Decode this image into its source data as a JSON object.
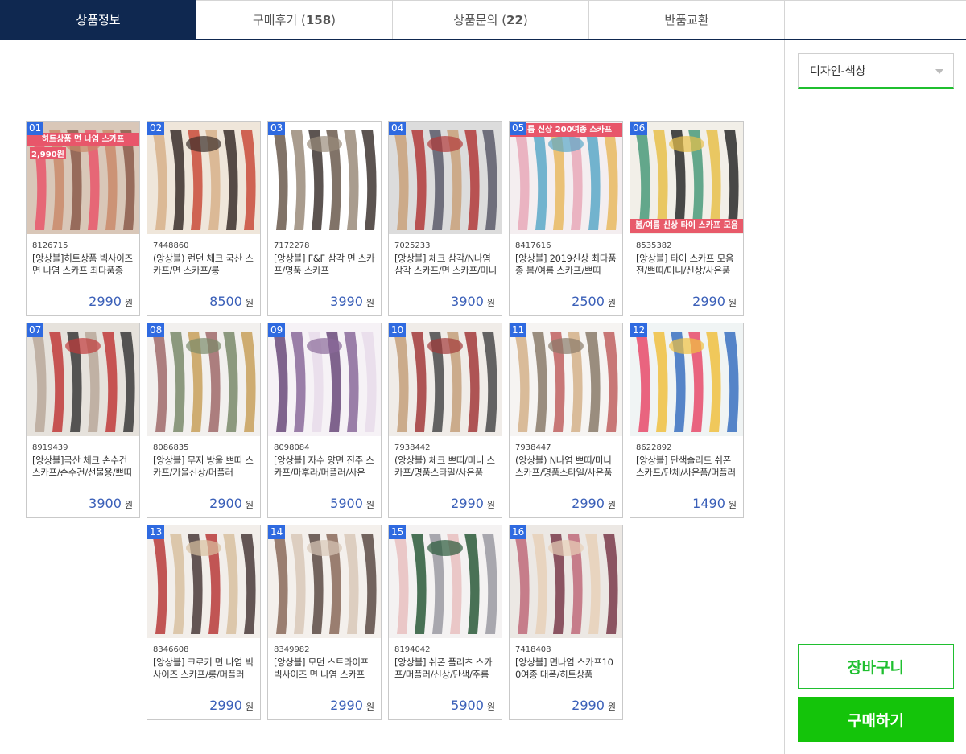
{
  "tabs": [
    {
      "label": "상품정보",
      "count": ""
    },
    {
      "label": "구매후기",
      "count": "158"
    },
    {
      "label": "상품문의",
      "count": "22"
    },
    {
      "label": "반품교환",
      "count": ""
    }
  ],
  "side": {
    "select_value": "디자인-색상",
    "cart_label": "장바구니",
    "buy_label": "구매하기"
  },
  "currency": "원",
  "products": [
    {
      "num": "01",
      "code": "8126715",
      "name": "[앙상블]히트상품 빅사이즈 면 나염 스카프 최다품종",
      "price": "2990",
      "banner": "히트상품 면 나염 스카프",
      "banner2": "2,990원"
    },
    {
      "num": "02",
      "code": "7448860",
      "name": "(앙상블) 런던 체크 국산 스카프/면 스카프/롱",
      "price": "8500"
    },
    {
      "num": "03",
      "code": "7172278",
      "name": "[앙상블] F&F 삼각 면 스카프/명품 스카프",
      "price": "3990"
    },
    {
      "num": "04",
      "code": "7025233",
      "name": "[앙상블] 체크 삼각/N나염 삼각 스카프/면 스카프/미니",
      "price": "3900"
    },
    {
      "num": "05",
      "code": "8417616",
      "name": "[앙상블] 2019신상 최다품종 봄/여름 스카프/쁘띠",
      "price": "2500",
      "banner": "여름 신상 200여종 스카프"
    },
    {
      "num": "06",
      "code": "8535382",
      "name": "[앙상블] 타이 스카프 모음전/쁘띠/미니/신상/사은품",
      "price": "2990",
      "banner": "봄/여름 신상 타이 스카프 모음"
    },
    {
      "num": "07",
      "code": "8919439",
      "name": "[앙상블]국산 체크 손수건 스카프/손수건/선물용/쁘띠",
      "price": "3900"
    },
    {
      "num": "08",
      "code": "8086835",
      "name": "[앙상블] 무지 방울 쁘띠 스카프/가을신상/머플러",
      "price": "2900"
    },
    {
      "num": "09",
      "code": "8098084",
      "name": "[앙상블] 자수 양면 진주 스카프/마후라/머플러/사은",
      "price": "5900"
    },
    {
      "num": "10",
      "code": "7938442",
      "name": "(앙상블) 체크 쁘띠/미니 스카프/명품스타일/사은품",
      "price": "2990"
    },
    {
      "num": "11",
      "code": "7938447",
      "name": "(앙상블) N나염 쁘띠/미니 스카프/명품스타일/사은품",
      "price": "2990"
    },
    {
      "num": "12",
      "code": "8622892",
      "name": "[앙상블] 단색솔리드 쉬폰 스카프/단체/사은품/머플러",
      "price": "1490"
    },
    {
      "num": "13",
      "code": "8346608",
      "name": "[앙상블] 크로키 면 나염 빅 사이즈 스카프/롱/머플러",
      "price": "2990"
    },
    {
      "num": "14",
      "code": "8349982",
      "name": "[앙상블] 모던 스트라이프 빅사이즈 면 나염 스카프",
      "price": "2990"
    },
    {
      "num": "15",
      "code": "8194042",
      "name": "[앙상블] 쉬폰 플리츠 스카프/머플러/신상/단색/주름",
      "price": "5900"
    },
    {
      "num": "16",
      "code": "7418408",
      "name": "[앙상블] 면나염 스카프100여종 대폭/히트상품",
      "price": "2990"
    }
  ]
}
